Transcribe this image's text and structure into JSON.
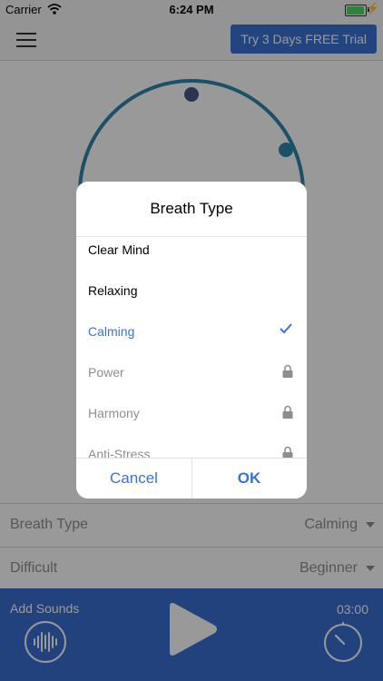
{
  "status": {
    "carrier": "Carrier",
    "time": "6:24 PM"
  },
  "header": {
    "trial_button": "Try 3 Days FREE Trial"
  },
  "settings_rows": [
    {
      "label": "Breath Type",
      "value": "Calming"
    },
    {
      "label": "Difficult",
      "value": "Beginner"
    }
  ],
  "player": {
    "add_sounds": "Add Sounds",
    "timer": "03:00"
  },
  "modal": {
    "title": "Breath Type",
    "options": [
      {
        "label": "Clear Mind",
        "state": "available"
      },
      {
        "label": "Relaxing",
        "state": "available"
      },
      {
        "label": "Calming",
        "state": "selected"
      },
      {
        "label": "Power",
        "state": "locked"
      },
      {
        "label": "Harmony",
        "state": "locked"
      },
      {
        "label": "Anti-Stress",
        "state": "locked"
      }
    ],
    "cancel": "Cancel",
    "ok": "OK"
  },
  "colors": {
    "accent": "#3a73d6",
    "arc": "#2d87ac",
    "arc_dot": "#4a5586",
    "locked": "#8e8e8e",
    "overlay": "rgba(0,0,0,0.40)"
  }
}
